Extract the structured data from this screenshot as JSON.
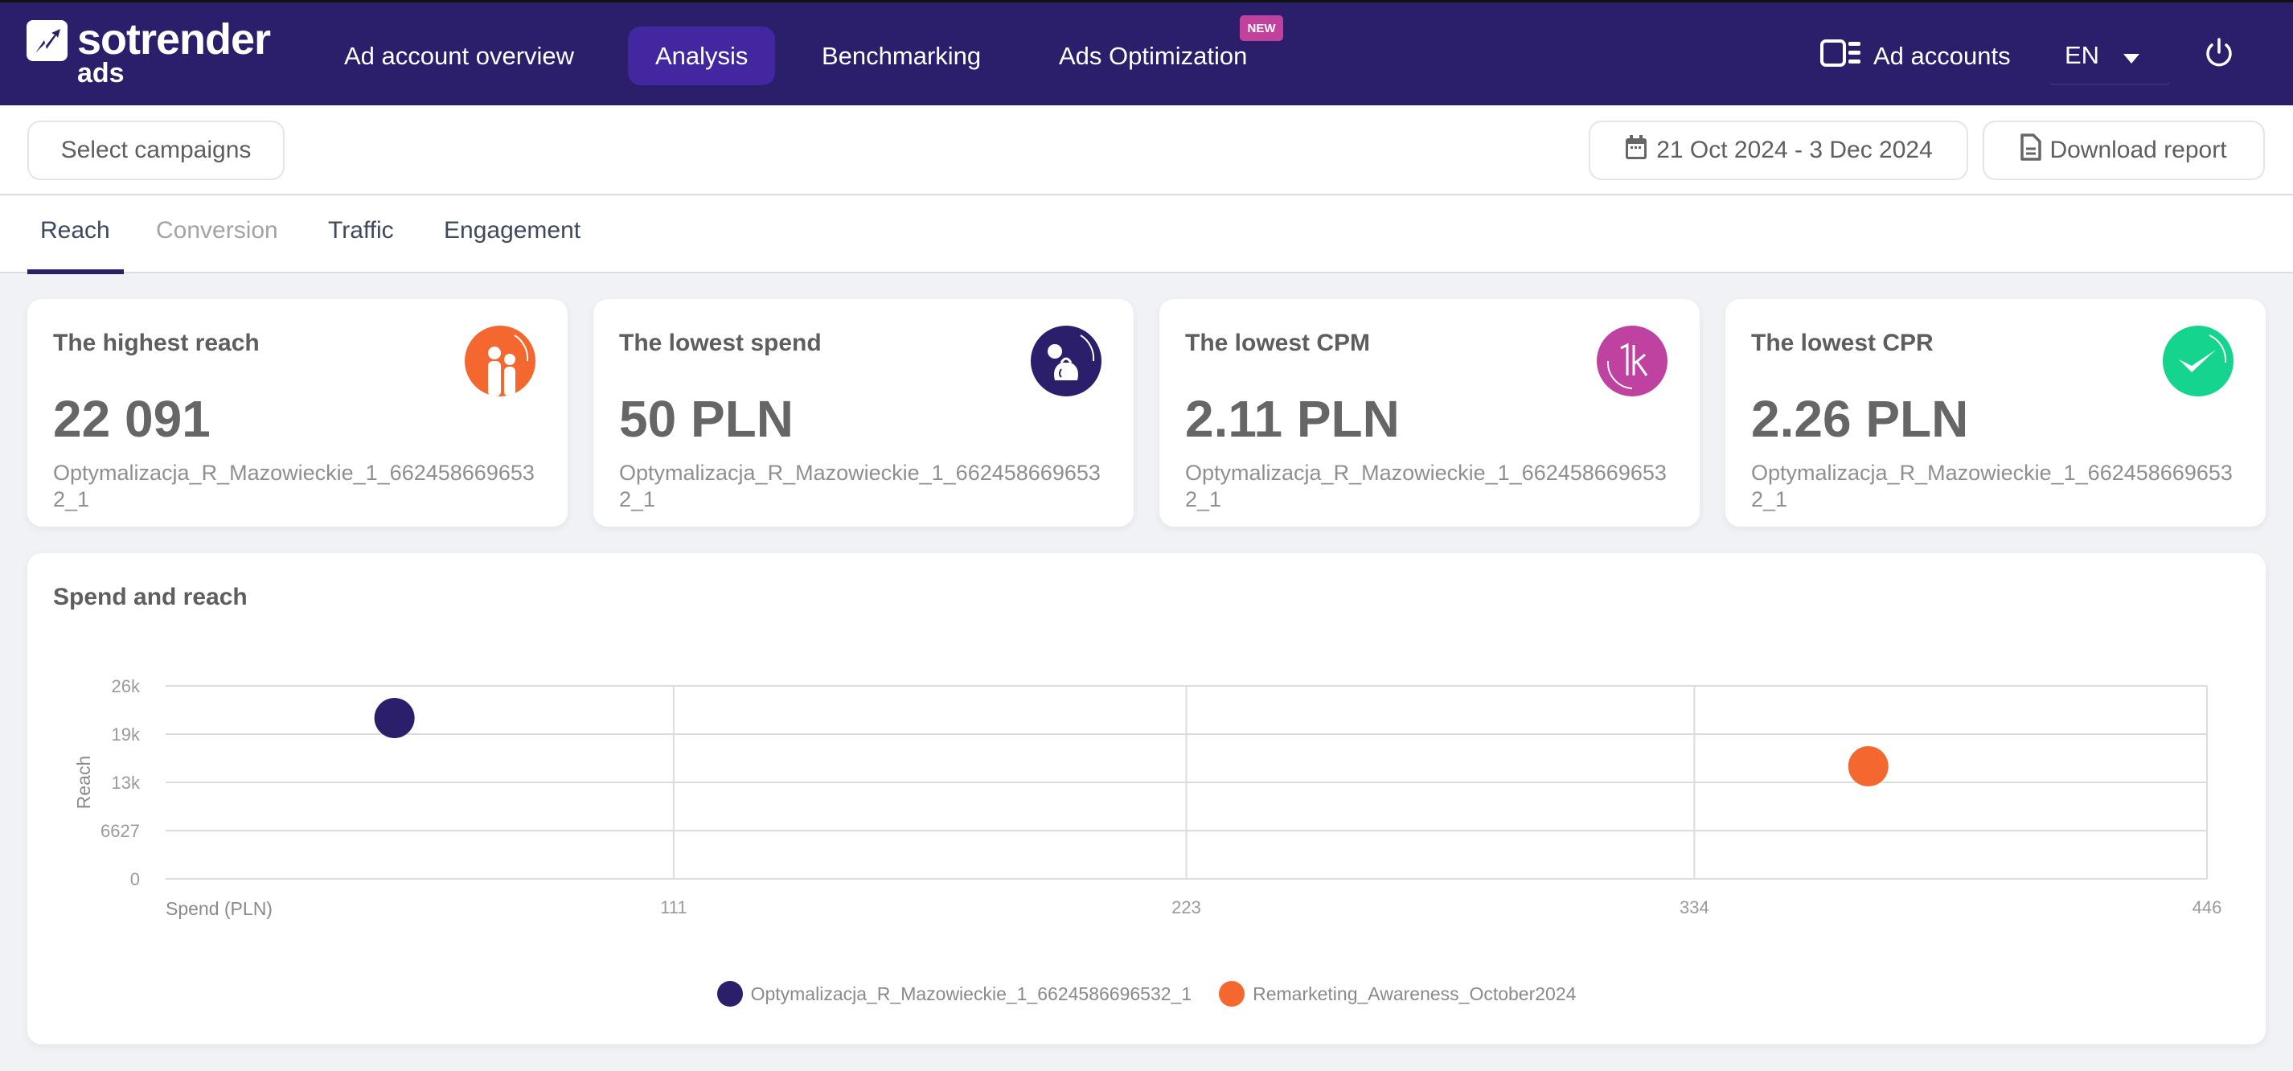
{
  "header": {
    "logo_brand": "sotrender",
    "logo_sub": "ads",
    "nav": [
      {
        "label": "Ad account overview",
        "active": false
      },
      {
        "label": "Analysis",
        "active": true
      },
      {
        "label": "Benchmarking",
        "active": false
      },
      {
        "label": "Ads Optimization",
        "active": false,
        "badge": "NEW"
      }
    ],
    "ad_accounts_label": "Ad accounts",
    "language": "EN",
    "icons": {
      "logo": "trend-arrow-icon",
      "ad_accounts": "ad-accounts-icon",
      "language_dropdown": "caret-down-icon",
      "logout": "power-icon"
    }
  },
  "filters": {
    "select_campaigns_label": "Select campaigns",
    "date_range": "21 Oct 2024 - 3 Dec 2024",
    "download_label": "Download report",
    "icons": {
      "date": "calendar-icon",
      "download": "document-icon"
    }
  },
  "tabs": [
    {
      "label": "Reach",
      "state": "active"
    },
    {
      "label": "Conversion",
      "state": "disabled"
    },
    {
      "label": "Traffic",
      "state": "normal"
    },
    {
      "label": "Engagement",
      "state": "normal"
    }
  ],
  "kpis": [
    {
      "title": "The highest reach",
      "value": "22 091",
      "campaign": "Optymalizacja_R_Mazowieckie_1_6624586696532_1",
      "icon": "people-icon",
      "color": "#f4672f"
    },
    {
      "title": "The lowest spend",
      "value": "50 PLN",
      "campaign": "Optymalizacja_R_Mazowieckie_1_6624586696532_1",
      "icon": "money-bag-icon",
      "color": "#2b1f6b"
    },
    {
      "title": "The lowest CPM",
      "value": "2.11 PLN",
      "campaign": "Optymalizacja_R_Mazowieckie_1_6624586696532_1",
      "icon": "thousand-icon",
      "color": "#bf42a0"
    },
    {
      "title": "The lowest CPR",
      "value": "2.26 PLN",
      "campaign": "Optymalizacja_R_Mazowieckie_1_6624586696532_1",
      "icon": "checkmark-icon",
      "color": "#14d48e"
    }
  ],
  "chart_data": {
    "type": "scatter",
    "title": "Spend and reach",
    "xlabel": "Spend (PLN)",
    "ylabel": "Reach",
    "xlim": [
      0,
      446
    ],
    "ylim": [
      0,
      26508
    ],
    "x_ticks": [
      111,
      223,
      334,
      446
    ],
    "x_tick_labels": [
      "111",
      "223",
      "334",
      "446"
    ],
    "y_ticks": [
      0,
      6627,
      13254,
      19881,
      26508
    ],
    "y_tick_labels": [
      "0",
      "6627",
      "13k",
      "19k",
      "26k"
    ],
    "grid": true,
    "legend_position": "bottom-center",
    "series": [
      {
        "name": "Optymalizacja_R_Mazowieckie_1_6624586696532_1",
        "color": "#2b1f6b",
        "points": [
          {
            "x": 50,
            "y": 22091
          }
        ]
      },
      {
        "name": "Remarketing_Awareness_October2024",
        "color": "#f4672f",
        "points": [
          {
            "x": 372,
            "y": 15460
          }
        ]
      }
    ]
  }
}
